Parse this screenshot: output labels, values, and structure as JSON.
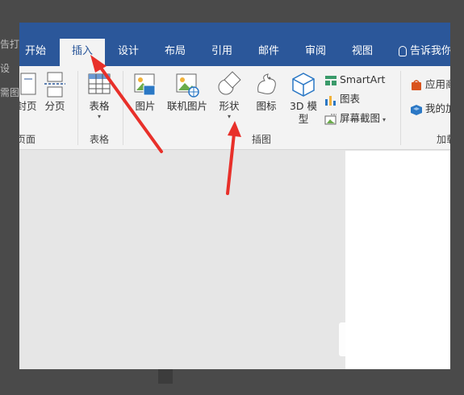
{
  "background": {
    "left_fragments": [
      "告打",
      "设",
      "需图"
    ]
  },
  "tabs": [
    {
      "label": "开始",
      "active": false
    },
    {
      "label": "插入",
      "active": true
    },
    {
      "label": "设计",
      "active": false
    },
    {
      "label": "布局",
      "active": false
    },
    {
      "label": "引用",
      "active": false
    },
    {
      "label": "邮件",
      "active": false
    },
    {
      "label": "审阅",
      "active": false
    },
    {
      "label": "视图",
      "active": false
    }
  ],
  "tell_me": "告诉我你",
  "ribbon": {
    "pages_group": {
      "cover_label": "封页",
      "break_label": "分页",
      "group_label": "页面"
    },
    "tables_group": {
      "table_label": "表格",
      "group_label": "表格"
    },
    "illustrations_group": {
      "picture_label": "图片",
      "online_picture_label": "联机图片",
      "shapes_label": "形状",
      "icons_label": "图标",
      "model3d_label": "3D 模型",
      "smartart_label": "SmartArt",
      "chart_label": "图表",
      "screenshot_label": "屏幕截图",
      "group_label": "插图"
    },
    "addins_group": {
      "store_label": "应用商",
      "myaddins_label": "我的加",
      "group_label": "加载"
    }
  },
  "colors": {
    "tab_bar": "#2b579a",
    "arrow": "#e8302a",
    "ribbon": "#f3f3f3"
  }
}
